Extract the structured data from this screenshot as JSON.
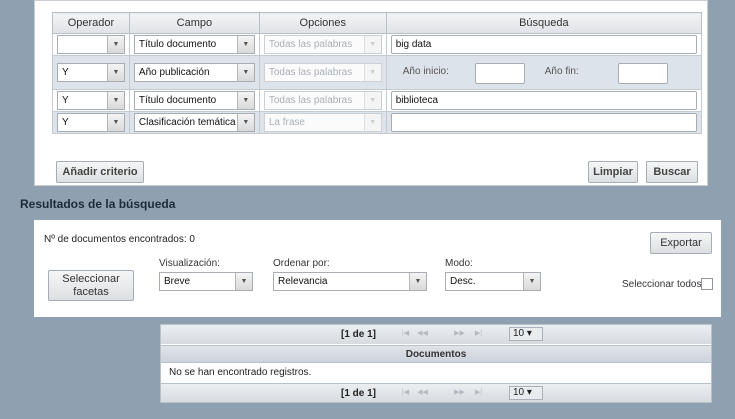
{
  "criteria": {
    "headers": [
      "Operador",
      "Campo",
      "Opciones",
      "Búsqueda"
    ],
    "rows": [
      {
        "operator": "",
        "field": "Título documento",
        "option": "Todas las palabras",
        "search": "big data"
      },
      {
        "operator": "Y",
        "field": "Año publicación",
        "option": "Todas las palabras",
        "year_start_label": "Año inicio:",
        "year_end_label": "Año fin:",
        "year_start": "",
        "year_end": ""
      },
      {
        "operator": "Y",
        "field": "Título documento",
        "option": "Todas las palabras",
        "search": "biblioteca"
      },
      {
        "operator": "Y",
        "field": "Clasificación temática",
        "option": "La frase",
        "search": ""
      }
    ],
    "add_button": "Añadir criterio",
    "clear_button": "Limpiar",
    "search_button": "Buscar"
  },
  "results": {
    "title": "Resultados de la búsqueda",
    "found_text": "Nº de documentos encontrados: 0",
    "export_button": "Exportar",
    "facets_button": "Seleccionar facetas",
    "visualization_label": "Visualización:",
    "visualization_value": "Breve",
    "order_label": "Ordenar por:",
    "order_value": "Relevancia",
    "mode_label": "Modo:",
    "mode_value": "Desc.",
    "select_all_label": "Seleccionar todos"
  },
  "grid": {
    "page_info": "[1 de 1]",
    "page_size": "10",
    "column_header": "Documentos",
    "empty_message": "No se han encontrado registros."
  }
}
